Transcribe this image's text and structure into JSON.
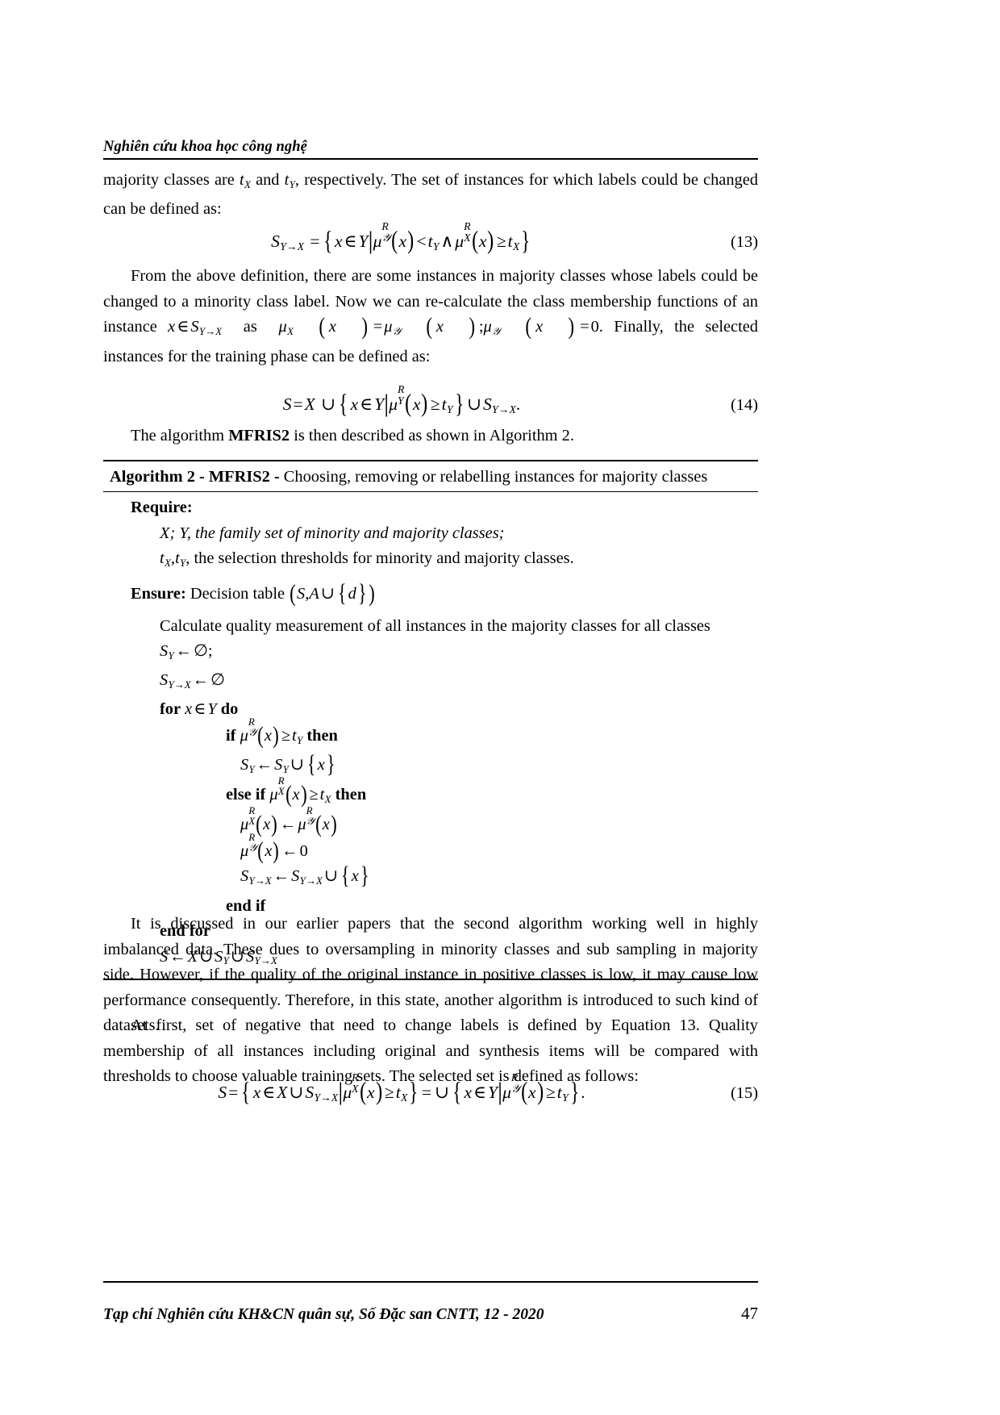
{
  "header": {
    "running_head": "Nghiên cứu khoa học công nghệ"
  },
  "paragraphs": {
    "p1_part1": "majority classes are ",
    "p1_tx": "t",
    "p1_tx_sub": "X",
    "p1_mid": " and ",
    "p1_ty": "t",
    "p1_ty_sub": "Y",
    "p1_part2": ", respectively. The set of instances for which labels could be changed can be defined as:",
    "p2_lead": "From the above definition, there are some instances in majority classes whose labels could be changed to a minority class label. Now we can re-calculate the class membership functions of an instance ",
    "p2_tail": ". Finally, the selected instances for the training phase can be defined as:",
    "p3_before": "The algorithm ",
    "p3_bold": "MFRIS2",
    "p3_after": " is then described as shown in Algorithm 2.",
    "p4": "It is discussed in our earlier papers that the second algorithm working well in highly imbalanced data. These dues to oversampling in minority classes and sub sampling in majority side. However, if the quality of the original instance in positive classes is low, it may cause low performance consequently. Therefore, in this state, another algorithm is introduced to such kind of datasets.",
    "p5": "At first, set of negative that need to change labels is defined by Equation 13. Quality membership of all instances including original and synthesis items will be compared with thresholds to choose valuable training sets. The selected set is defined as follows:"
  },
  "equations": {
    "eq13_number": "(13)",
    "eq13_text": "S_{Y→X} = { x ∈ Y | μ^R_𝒴(x) < t_Y ∧ μ^R_X(x) ≥ t_X }",
    "eq14_number": "(14)",
    "eq14_text": "S = X ∪ { x ∈ Y | μ^R_Y(x) ≥ t_Y } ∪ S_{Y→X}.",
    "eq15_number": "(15)",
    "eq15_text": "S = { x ∈ X ∪ S_{Y→X} | μ^R_X(x) ≥ t_X } = ∪ { x ∈ Y | μ^R_𝒴(x) ≥ t_Y }."
  },
  "algorithm": {
    "title_bold": "Algorithm 2 - MFRIS2 -",
    "title_rest": " Choosing, removing or relabelling instances for majority classes",
    "require_label": "Require:",
    "require_line1": "X; Y, the family set of minority and majority classes;",
    "require_line2_math": "t_X , t_Y ,",
    "require_line2_text": " the selection thresholds for minority and majority classes.",
    "ensure_label": "Ensure:",
    "ensure_text": "Decision table ",
    "ensure_math": "(S, A ∪ {d})",
    "step_calculate": "Calculate quality measurement of all instances in the majority classes for all classes",
    "step_sy_init": "S_Y ← ∅;",
    "step_syx_init": "S_{Y→X} ← ∅",
    "step_for": "for",
    "step_for_math": "x ∈ Y",
    "step_do": "do",
    "step_if": "if",
    "step_if_math": "μ^R_𝒴(x) ≥ t_Y",
    "step_then": "then",
    "step_sy_update": "S_Y ← S_Y ∪ {x}",
    "step_elseif": "else if",
    "step_elseif_math": "μ^R_X(x) ≥ t_X",
    "step_mux_update": "μ^R_X(x) ← μ^R_𝒴(x)",
    "step_muy_zero": "μ^R_𝒴(x) ← 0",
    "step_syx_update": "S_{Y→X} ← S_{Y→X} ∪ {x}",
    "step_endif": "end if",
    "step_endfor": "end for",
    "step_final": "S ← X ∪ S_Y ∪ S_{Y→X}"
  },
  "footer": {
    "journal": "Tạp chí Nghiên cứu KH&CN quân sự, Số Đặc san CNTT, 12 - 2020",
    "page_number": "47"
  }
}
